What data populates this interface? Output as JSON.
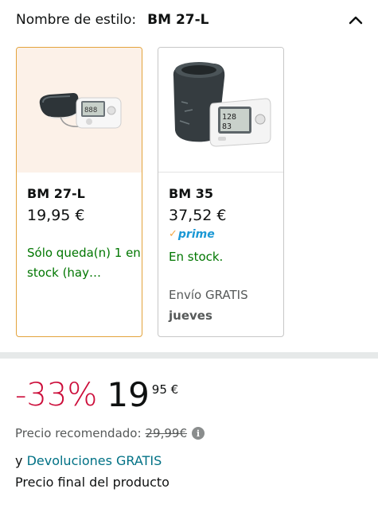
{
  "style_selector": {
    "label": "Nombre de estilo:",
    "value": "BM 27-L"
  },
  "options": [
    {
      "name": "BM 27-L",
      "price": "19,95 €",
      "availability": "Sólo queda(n) 1 en stock (hay…",
      "selected": true
    },
    {
      "name": "BM 35",
      "price": "37,52 €",
      "prime": "prime",
      "availability": "En stock.",
      "shipping": "Envío GRATIS",
      "shipping_day": "jueves",
      "selected": false
    }
  ],
  "pricing": {
    "discount": "-33%",
    "whole": "19",
    "fraction": "95 €",
    "recommended_label": "Precio recomendado:",
    "recommended_price": "29,99€",
    "returns_prefix": "y",
    "returns_link": "Devoluciones GRATIS",
    "final_price_label": "Precio final del producto"
  },
  "colors": {
    "discount_red": "#cc0c39",
    "in_stock_green": "#007600",
    "link_teal": "#007185",
    "prime_blue": "#1a98d5",
    "selected_border": "#e3a33c"
  }
}
